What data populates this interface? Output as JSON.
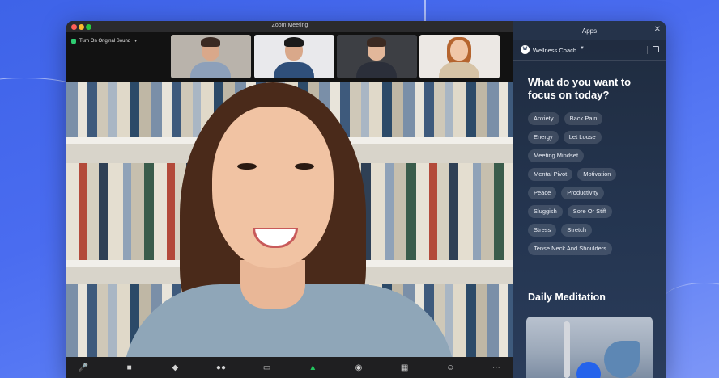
{
  "window": {
    "title": "Zoom Meeting"
  },
  "toolbar_top": {
    "sound_label": "Turn On Original Sound"
  },
  "participants": [
    {
      "name": "participant-1"
    },
    {
      "name": "participant-2"
    },
    {
      "name": "participant-3"
    },
    {
      "name": "participant-4"
    }
  ],
  "panel": {
    "title": "Apps",
    "app_name": "Wellness Coach",
    "question": "What do you want to focus on today?",
    "tags": [
      [
        "Anxiety",
        "Back Pain"
      ],
      [
        "Energy",
        "Let Loose"
      ],
      [
        "Meeting Mindset"
      ],
      [
        "Mental Pivot",
        "Motivation"
      ],
      [
        "Peace",
        "Productivity"
      ],
      [
        "Sluggish",
        "Sore Or Stiff"
      ],
      [
        "Stress",
        "Stretch"
      ],
      [
        "Tense Neck And Shoulders"
      ]
    ],
    "section_title": "Daily Meditation"
  },
  "colors": {
    "accent": "#2563eb",
    "share_green": "#22c55e",
    "panel_bg": "#243550"
  }
}
